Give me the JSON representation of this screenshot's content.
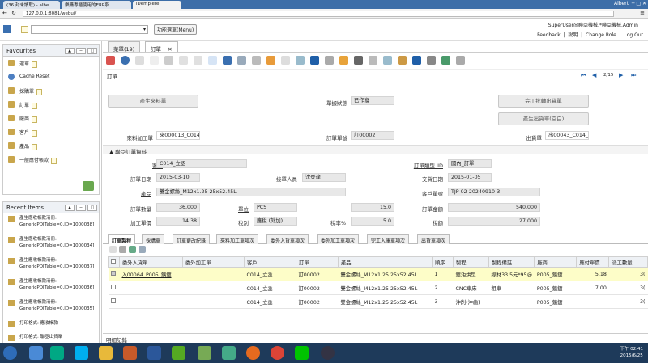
{
  "browser": {
    "tabs": [
      {
        "label": "(36 封未讀取) - albe..."
      },
      {
        "label": "樂購專櫃使用的ERP系..."
      },
      {
        "label": "iDempiere"
      }
    ],
    "user": "Albert",
    "url": "127.0.0.1:8081/webui/"
  },
  "header": {
    "menu_button": "功能選單(Menu)",
    "user_info": "SuperUser@聯亞機械.*聯亞機械.Admin",
    "links": [
      "Feedback",
      "說明",
      "Change Role",
      "Log Out"
    ]
  },
  "sidebar": {
    "favourites_title": "Favourites",
    "favourites": [
      "選單",
      "Cache Reset",
      "採購單",
      "訂單",
      "廠商",
      "客戶",
      "產品",
      "一般應付帳款"
    ],
    "recent_title": "Recent Items",
    "recent": [
      "產生應收帳款清冊: GenericPO[Table=0,ID=1000038]",
      "產生應收帳款清冊: GenericPO[Table=0,ID=1000034]",
      "產生應收帳款清冊: GenericPO[Table=0,ID=1000037]",
      "產生應收帳款清冊: GenericPO[Table=0,ID=1000036]",
      "產生應收帳款清冊: GenericPO[Table=0,ID=1000035]",
      "打印格式: 應收帳款",
      "打印格式: 聯亞出貨單"
    ]
  },
  "window_tabs": {
    "menu": "菜單(19)",
    "order": "訂單"
  },
  "form": {
    "title": "訂單",
    "record_nav": "2/15",
    "buttons": {
      "gen_material": "產生來料單",
      "gen_complete_ship": "完工批轉出貨單",
      "gen_ship_empty": "產生出貨單(空白)"
    },
    "doc_status_label": "單據狀態",
    "doc_status": "已作廢",
    "material_processing_label": "來料加工單",
    "material_processing": "來000013_C014_",
    "order_no_label": "訂單單號",
    "order_no": "訂00002",
    "shipment_label": "出貨單",
    "shipment": "出00043_C014_",
    "section_title": "聯亞訂單資料",
    "customer_label": "客戶",
    "customer": "C014_立丞",
    "order_type_label": "訂單類型_ID",
    "order_type": "國內_訂單",
    "order_date_label": "訂單日期",
    "order_date": "2015-03-10",
    "receiver_label": "接單人員",
    "receiver": "沈登達",
    "delivery_date_label": "交貨日期",
    "delivery_date": "2015-01-05",
    "product_label": "產品",
    "product": "雙金螺絲_M12x1.25 25x52.45L",
    "cust_order_label": "客戶單號",
    "cust_order": "TJP-02-20240910-3",
    "qty_label": "訂單數量",
    "qty": "36,000",
    "uom_label": "單位",
    "uom": "PCS",
    "price_label": "單價",
    "price": "15.0",
    "amount_label": "訂單金額",
    "amount": "540,000",
    "proc_price_label": "加工單價",
    "proc_price": "14.38",
    "tax_label": "稅別",
    "tax": "應稅 (外加)",
    "tax_rate_label": "稅率%",
    "tax_rate": "5.0",
    "tax_amount_label": "稅額",
    "tax_amount": "27,000"
  },
  "detail_tabs": [
    "訂單製程",
    "採購單",
    "訂單更改紀錄",
    "來料加工單項次",
    "委外入貨單項次",
    "委外加工單項次",
    "完工入庫單項次",
    "出貨單項次"
  ],
  "grid": {
    "headers": [
      "",
      "委外入貨單",
      "委外加工單",
      "客戶",
      "訂單",
      "產品",
      "順序",
      "製程",
      "製程備註",
      "廠商",
      "應付單價",
      "派工數量"
    ],
    "rows": [
      [
        "入00064_P005_鑛鍍",
        "",
        "C014_立丞",
        "訂00002",
        "雙金螺絲_M12x1.25 25x52.45L",
        "1",
        "鍍油烘型",
        "線材33.5元*95@",
        "P005_鑛鍍",
        "5.18",
        "3("
      ],
      [
        "",
        "",
        "C014_立丞",
        "訂00002",
        "雙金螺絲_M12x1.25 25x52.45L",
        "2",
        "CNC車床",
        "租車",
        "P005_鑛鍍",
        "7.00",
        "3("
      ],
      [
        "",
        "",
        "C014_立丞",
        "訂00002",
        "雙金螺絲_M12x1.25 25x52.45L",
        "3",
        "沖削(沖齒)",
        "",
        "P005_鑛鍍",
        "",
        "3("
      ]
    ]
  },
  "detail_record": "明細記錄",
  "taskbar": {
    "time": "下午 02:41",
    "date": "2015/6/25"
  },
  "colors": {
    "accent": "#1f5fa8",
    "selected_row": "#fdfdc8",
    "taskbar": "#1e3a5a"
  }
}
